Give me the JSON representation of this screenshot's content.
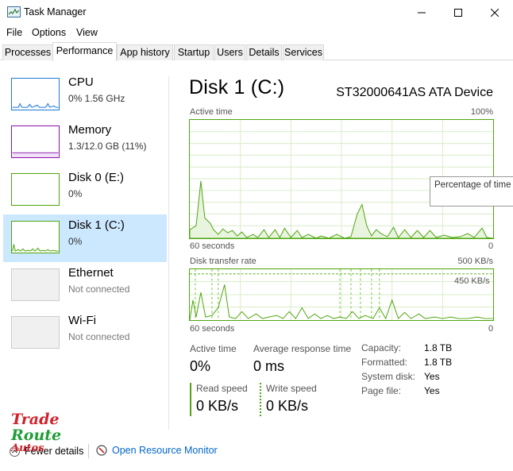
{
  "window": {
    "title": "Task Manager"
  },
  "menu": [
    {
      "label": "File"
    },
    {
      "label": "Options"
    },
    {
      "label": "View"
    }
  ],
  "tabs": [
    {
      "label": "Processes"
    },
    {
      "label": "Performance"
    },
    {
      "label": "App history"
    },
    {
      "label": "Startup"
    },
    {
      "label": "Users"
    },
    {
      "label": "Details"
    },
    {
      "label": "Services"
    }
  ],
  "active_tab": "Performance",
  "sidebar": [
    {
      "name": "CPU",
      "sub": "0% 1.56 GHz",
      "color": "#1c7ad4"
    },
    {
      "name": "Memory",
      "sub": "1.3/12.0 GB (11%)",
      "color": "#8b12ae"
    },
    {
      "name": "Disk 0 (E:)",
      "sub": "0%",
      "color": "#4da60c"
    },
    {
      "name": "Disk 1 (C:)",
      "sub": "0%",
      "color": "#4da60c"
    },
    {
      "name": "Ethernet",
      "sub": "Not connected",
      "color": "#aaaaaa"
    },
    {
      "name": "Wi-Fi",
      "sub": "Not connected",
      "color": "#aaaaaa"
    }
  ],
  "selected_item": "Disk 1 (C:)",
  "main": {
    "title": "Disk 1 (C:)",
    "device": "ST32000641AS ATA Device",
    "graph1": {
      "label": "Active time",
      "max_label": "100%",
      "time_label": "60 seconds",
      "min_label": "0",
      "values_percent": [
        0,
        0,
        0,
        0,
        0,
        0,
        0,
        0,
        0,
        0,
        0,
        0,
        0,
        0,
        0,
        0,
        0,
        0,
        0,
        0,
        0,
        0,
        0,
        0,
        0,
        0,
        0,
        0,
        0,
        0,
        0,
        0,
        0,
        0,
        0,
        0,
        0,
        0,
        0,
        0,
        0,
        0,
        0,
        0,
        0,
        0,
        0,
        0,
        0,
        0,
        0,
        0,
        0,
        0,
        0,
        0,
        0,
        0,
        0,
        0
      ]
    },
    "graph2": {
      "label": "Disk transfer rate",
      "max_label": "500 KB/s",
      "line_label": "450 KB/s",
      "time_label": "60 seconds",
      "min_label": "0"
    },
    "tooltip": "Percentage of time the disk is processing read or write requests",
    "stats": {
      "active_time_label": "Active time",
      "active_time_value": "0%",
      "response_label": "Average response time",
      "response_value": "0 ms",
      "read_label": "Read speed",
      "read_value": "0 KB/s",
      "write_label": "Write speed",
      "write_value": "0 KB/s"
    },
    "info": [
      {
        "label": "Capacity:",
        "value": "1.8 TB"
      },
      {
        "label": "Formatted:",
        "value": "1.8 TB"
      },
      {
        "label": "System disk:",
        "value": "Yes"
      },
      {
        "label": "Page file:",
        "value": "Yes"
      }
    ]
  },
  "footer": {
    "fewer_details": "Fewer details",
    "resource_monitor": "Open Resource Monitor"
  },
  "watermark": {
    "line1": "Trade",
    "line2": "Route",
    "line3": "Autos"
  },
  "colors": {
    "disk_green": "#4da60c",
    "selection": "#cce8ff",
    "link": "#0066cc"
  }
}
